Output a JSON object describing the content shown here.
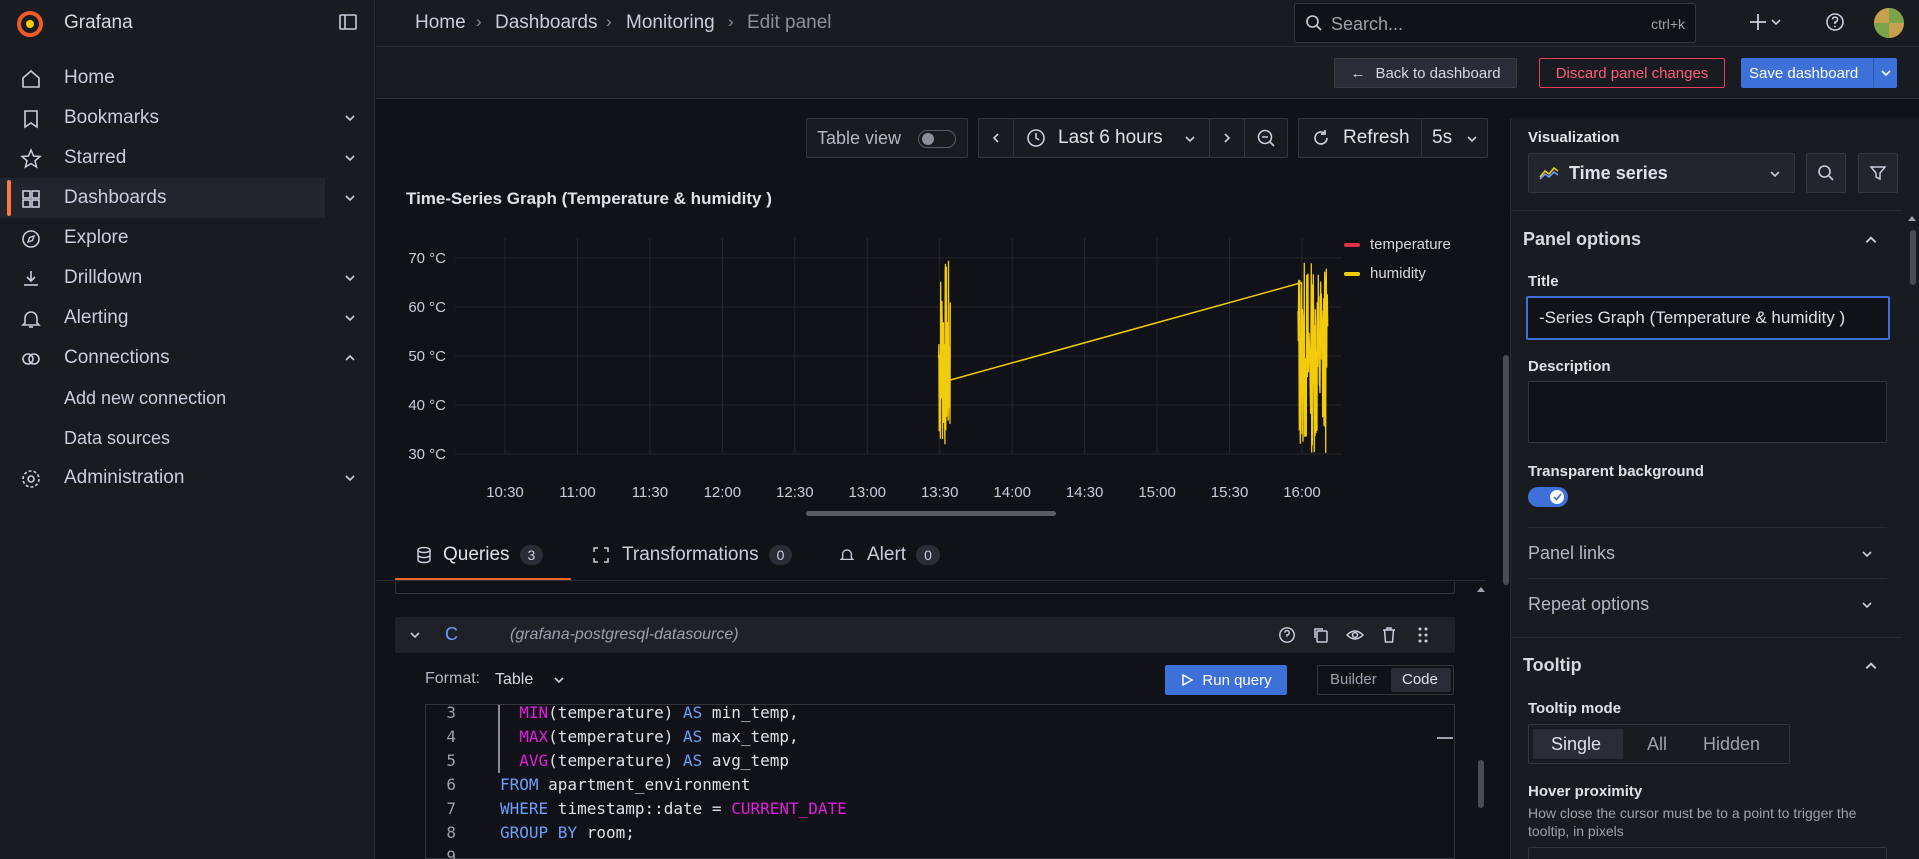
{
  "app": {
    "name": "Grafana"
  },
  "sidebar": {
    "items": [
      {
        "label": "Home",
        "icon": "home-icon"
      },
      {
        "label": "Bookmarks",
        "icon": "bookmark-icon"
      },
      {
        "label": "Starred",
        "icon": "star-icon"
      },
      {
        "label": "Dashboards",
        "icon": "dashboards-icon"
      },
      {
        "label": "Explore",
        "icon": "compass-icon"
      },
      {
        "label": "Drilldown",
        "icon": "drilldown-icon"
      },
      {
        "label": "Alerting",
        "icon": "bell-icon"
      },
      {
        "label": "Connections",
        "icon": "connections-icon"
      },
      {
        "label": "Add new connection"
      },
      {
        "label": "Data sources"
      },
      {
        "label": "Administration",
        "icon": "gear-icon"
      }
    ]
  },
  "breadcrumb": [
    "Home",
    "Dashboards",
    "Monitoring",
    "Edit panel"
  ],
  "search": {
    "placeholder": "Search...",
    "shortcut": "ctrl+k"
  },
  "toolbar": {
    "back": "Back to dashboard",
    "discard": "Discard panel changes",
    "save": "Save dashboard"
  },
  "panel_controls": {
    "table_view": "Table view",
    "time_range": "Last 6 hours",
    "refresh": "Refresh",
    "refresh_interval": "5s"
  },
  "panel": {
    "title": "Time-Series Graph (Temperature & humidity )"
  },
  "chart_data": {
    "type": "line",
    "title": "Time-Series Graph (Temperature & humidity )",
    "y_ticks": [
      "70 °C",
      "60 °C",
      "50 °C",
      "40 °C",
      "30 °C"
    ],
    "ylim": [
      30,
      70
    ],
    "x_ticks": [
      "10:30",
      "11:00",
      "11:30",
      "12:00",
      "12:30",
      "13:00",
      "13:30",
      "14:00",
      "14:30",
      "15:00",
      "15:30",
      "16:00"
    ],
    "grid": true,
    "legend_position": "top-right",
    "series": [
      {
        "name": "temperature",
        "color": "#e02f44",
        "x": [],
        "y": []
      },
      {
        "name": "humidity",
        "color": "#f2cc0c",
        "x": [
          "13:32",
          "13:33",
          "16:00",
          "16:05"
        ],
        "y": [
          45,
          45,
          65,
          65
        ]
      }
    ]
  },
  "tabs": [
    {
      "label": "Queries",
      "count": "3"
    },
    {
      "label": "Transformations",
      "count": "0"
    },
    {
      "label": "Alert",
      "count": "0"
    }
  ],
  "query": {
    "ref": "C",
    "datasource": "(grafana-postgresql-datasource)",
    "format_label": "Format:",
    "format_value": "Table",
    "run": "Run query",
    "mode_builder": "Builder",
    "mode_code": "Code",
    "lines": [
      {
        "n": "3",
        "parts": [
          [
            "kw-pink",
            "  MIN"
          ],
          [
            "txt",
            "(temperature) "
          ],
          [
            "kw-blue",
            "AS"
          ],
          [
            "txt",
            " min_temp,"
          ]
        ]
      },
      {
        "n": "4",
        "parts": [
          [
            "kw-pink",
            "  MAX"
          ],
          [
            "txt",
            "(temperature) "
          ],
          [
            "kw-blue",
            "AS"
          ],
          [
            "txt",
            " max_temp,"
          ]
        ]
      },
      {
        "n": "5",
        "parts": [
          [
            "kw-pink",
            "  AVG"
          ],
          [
            "txt",
            "(temperature) "
          ],
          [
            "kw-blue",
            "AS"
          ],
          [
            "txt",
            " avg_temp"
          ]
        ]
      },
      {
        "n": "6",
        "parts": [
          [
            "kw-blue",
            "FROM"
          ],
          [
            "txt",
            " apartment_environment"
          ]
        ]
      },
      {
        "n": "7",
        "parts": [
          [
            "kw-blue",
            "WHERE"
          ],
          [
            "txt",
            " timestamp::date = "
          ],
          [
            "kw-pink",
            "CURRENT_DATE"
          ]
        ]
      },
      {
        "n": "8",
        "parts": [
          [
            "kw-blue",
            "GROUP BY"
          ],
          [
            "txt",
            " room;"
          ]
        ]
      },
      {
        "n": "9",
        "parts": []
      }
    ]
  },
  "options": {
    "visualization_label": "Visualization",
    "visualization_value": "Time series",
    "panel_options": "Panel options",
    "title_label": "Title",
    "title_value": "-Series Graph (Temperature & humidity )",
    "description_label": "Description",
    "transparent_label": "Transparent background",
    "panel_links": "Panel links",
    "repeat_options": "Repeat options",
    "tooltip": "Tooltip",
    "tooltip_mode_label": "Tooltip mode",
    "tooltip_modes": [
      "Single",
      "All",
      "Hidden"
    ],
    "hover_label": "Hover proximity",
    "hover_desc": "How close the cursor must be to a point to trigger the tooltip, in pixels"
  }
}
